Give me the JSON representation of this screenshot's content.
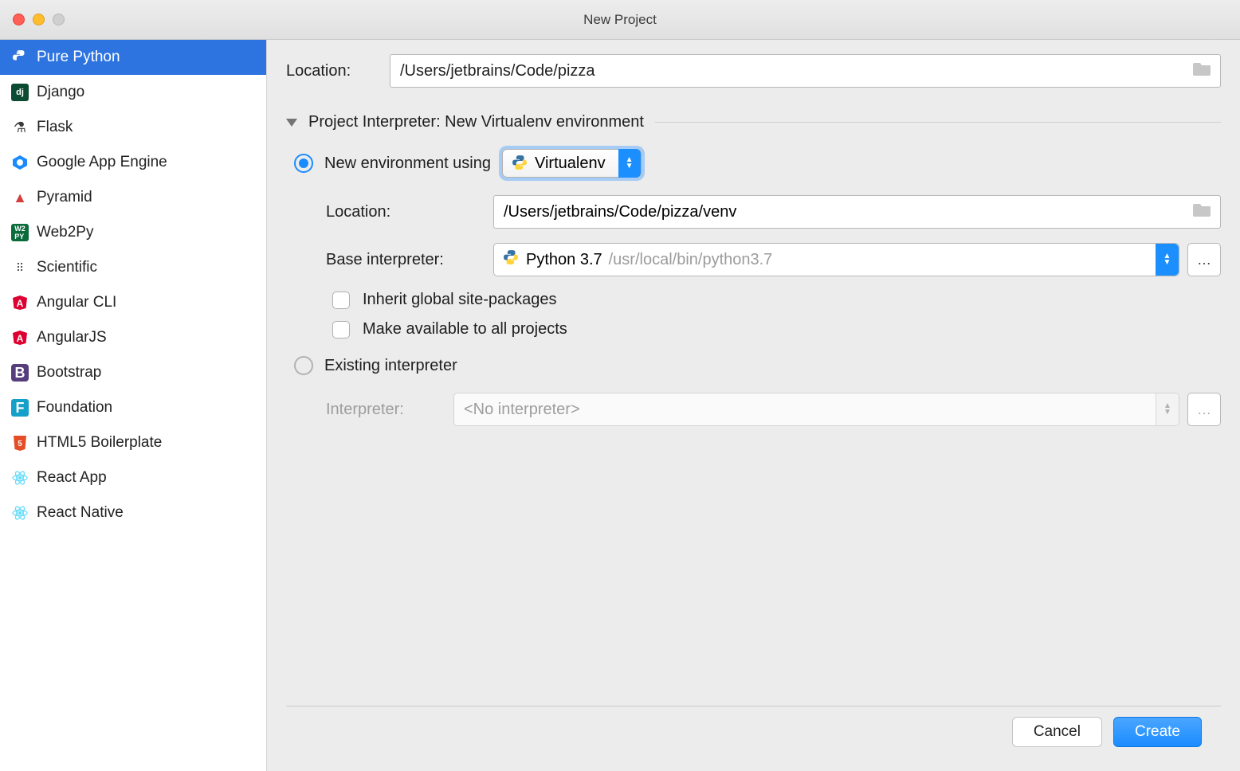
{
  "window": {
    "title": "New Project"
  },
  "sidebar": {
    "items": [
      {
        "label": "Pure Python",
        "icon": "python"
      },
      {
        "label": "Django",
        "icon": "django"
      },
      {
        "label": "Flask",
        "icon": "flask"
      },
      {
        "label": "Google App Engine",
        "icon": "gae"
      },
      {
        "label": "Pyramid",
        "icon": "pyramid"
      },
      {
        "label": "Web2Py",
        "icon": "web2py"
      },
      {
        "label": "Scientific",
        "icon": "scientific"
      },
      {
        "label": "Angular CLI",
        "icon": "angular"
      },
      {
        "label": "AngularJS",
        "icon": "angular"
      },
      {
        "label": "Bootstrap",
        "icon": "bootstrap"
      },
      {
        "label": "Foundation",
        "icon": "foundation"
      },
      {
        "label": "HTML5 Boilerplate",
        "icon": "html5"
      },
      {
        "label": "React App",
        "icon": "react"
      },
      {
        "label": "React Native",
        "icon": "react"
      }
    ],
    "selected_index": 0
  },
  "form": {
    "location_label": "Location:",
    "location_value": "/Users/jetbrains/Code/pizza",
    "section_title": "Project Interpreter: New Virtualenv environment",
    "new_env": {
      "radio_label": "New environment using",
      "combo_value": "Virtualenv",
      "location_label": "Location:",
      "location_value": "/Users/jetbrains/Code/pizza/venv",
      "base_label": "Base interpreter:",
      "base_name": "Python 3.7",
      "base_path": "/usr/local/bin/python3.7",
      "inherit_label": "Inherit global site-packages",
      "make_avail_label": "Make available to all projects"
    },
    "existing": {
      "radio_label": "Existing interpreter",
      "interpreter_label": "Interpreter:",
      "interpreter_value": "<No interpreter>"
    }
  },
  "footer": {
    "cancel": "Cancel",
    "create": "Create"
  }
}
